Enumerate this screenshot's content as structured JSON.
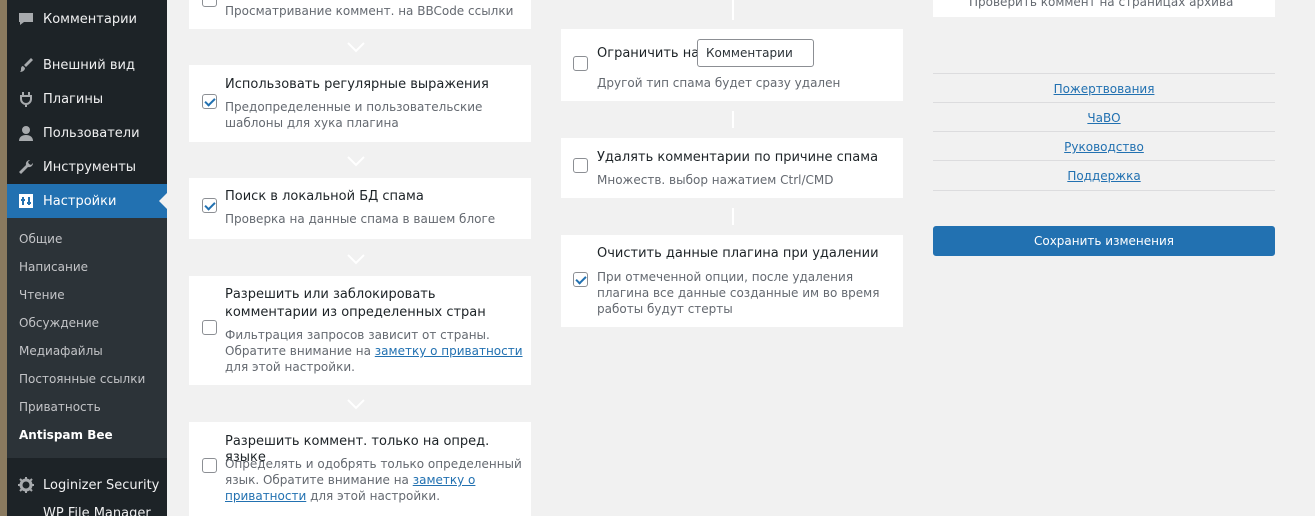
{
  "sidebar": {
    "items": [
      {
        "label": "Комментарии",
        "icon": "comment-icon"
      },
      {
        "label": "Внешний вид",
        "icon": "brush-icon"
      },
      {
        "label": "Плагины",
        "icon": "plugin-icon"
      },
      {
        "label": "Пользователи",
        "icon": "user-icon"
      },
      {
        "label": "Инструменты",
        "icon": "wrench-icon"
      },
      {
        "label": "Настройки",
        "icon": "settings-icon"
      },
      {
        "label": "Loginizer Security",
        "icon": "gear-icon"
      }
    ],
    "submenu": [
      "Общие",
      "Написание",
      "Чтение",
      "Обсуждение",
      "Медиафайлы",
      "Постоянные ссылки",
      "Приватность",
      "Antispam Bee"
    ],
    "partial_bottom": "WP File Manager"
  },
  "col1": {
    "top_partial_desc": "Просматривание коммент. на BBCode ссылки",
    "regex": {
      "title": "Использовать регулярные выражения",
      "desc_l1": "Предопределенные и пользовательские",
      "desc_l2": "шаблоны для хука плагина"
    },
    "localdb": {
      "title": "Поиск в локальной БД спама",
      "desc": "Проверка на данные спама в вашем блоге"
    },
    "country": {
      "title_l1": "Разрешить или заблокировать",
      "title_l2": "комментарии из определенных стран",
      "desc_l1": "Фильтрация запросов зависит от страны.",
      "desc_l2_pre": "Обратите внимание на ",
      "desc_l2_link": "заметку о приватности",
      "desc_l3": "для этой настройки."
    },
    "language": {
      "title": "Разрешить коммент. только на опред. языке",
      "desc_l1": "Определять и одобрять только определенный",
      "desc_l2_pre": "язык. Обратите внимание на ",
      "desc_l2_link": "заметку о",
      "desc_l3_link": "приватности",
      "desc_l3_post": " для этой настройки."
    }
  },
  "col2": {
    "limit": {
      "title": "Ограничить на",
      "select_value": "Комментарии",
      "desc": "Другой тип спама будет сразу удален"
    },
    "delete_reason": {
      "title": "Удалять комментарии по причине спама",
      "desc": "Множеств. выбор нажатием Ctrl/CMD"
    },
    "cleanup": {
      "title": "Очистить данные плагина при удалении",
      "desc_l1": "При отмеченной опции, после удаления",
      "desc_l2": "плагина все данные созданные им во время",
      "desc_l3": "работы будут стерты"
    }
  },
  "col3": {
    "top_partial": "Проверить коммент на страницах архива",
    "links": [
      "Пожертвования",
      "ЧаВО",
      "Руководство",
      "Поддержка"
    ],
    "save_label": "Сохранить изменения"
  }
}
